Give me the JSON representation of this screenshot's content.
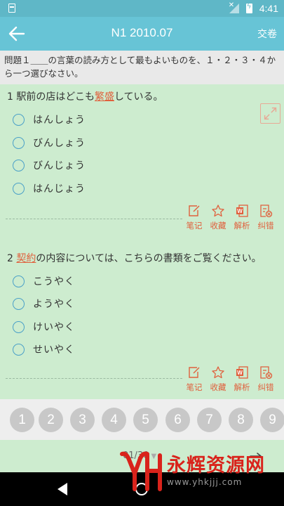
{
  "status": {
    "time": "4:41"
  },
  "header": {
    "title": "N1 2010.07",
    "submit_label": "交卷"
  },
  "instruction": "問題１＿＿の言葉の読み方として最もよいものを、１・２・３・４から一つ選びなさい。",
  "questions": [
    {
      "number": "1",
      "prefix": "駅前の店はどこも",
      "highlight": "繁盛",
      "suffix": "している。",
      "options": [
        "はんしょう",
        "びんしょう",
        "びんじょう",
        "はんじょう"
      ]
    },
    {
      "number": "2",
      "prefix": "",
      "highlight": "契約",
      "suffix": "の内容については、こちらの書類をご覧ください。",
      "options": [
        "こうやく",
        "ようやく",
        "けいやく",
        "せいやく"
      ]
    }
  ],
  "tools": [
    "笔记",
    "收藏",
    "解析",
    "纠错"
  ],
  "question_numbers": [
    "1",
    "2",
    "3",
    "4",
    "5",
    "6",
    "7",
    "8",
    "9"
  ],
  "pager": {
    "current": "01/30"
  },
  "watermark": {
    "name": "永辉资源网",
    "url": "www.yhkjjj.com"
  },
  "colors": {
    "appbar": "#67c4d6",
    "statusbar": "#5fb7c7",
    "accent": "#e0603d",
    "background": "#cdeccf",
    "radio": "#4aa0c8"
  }
}
